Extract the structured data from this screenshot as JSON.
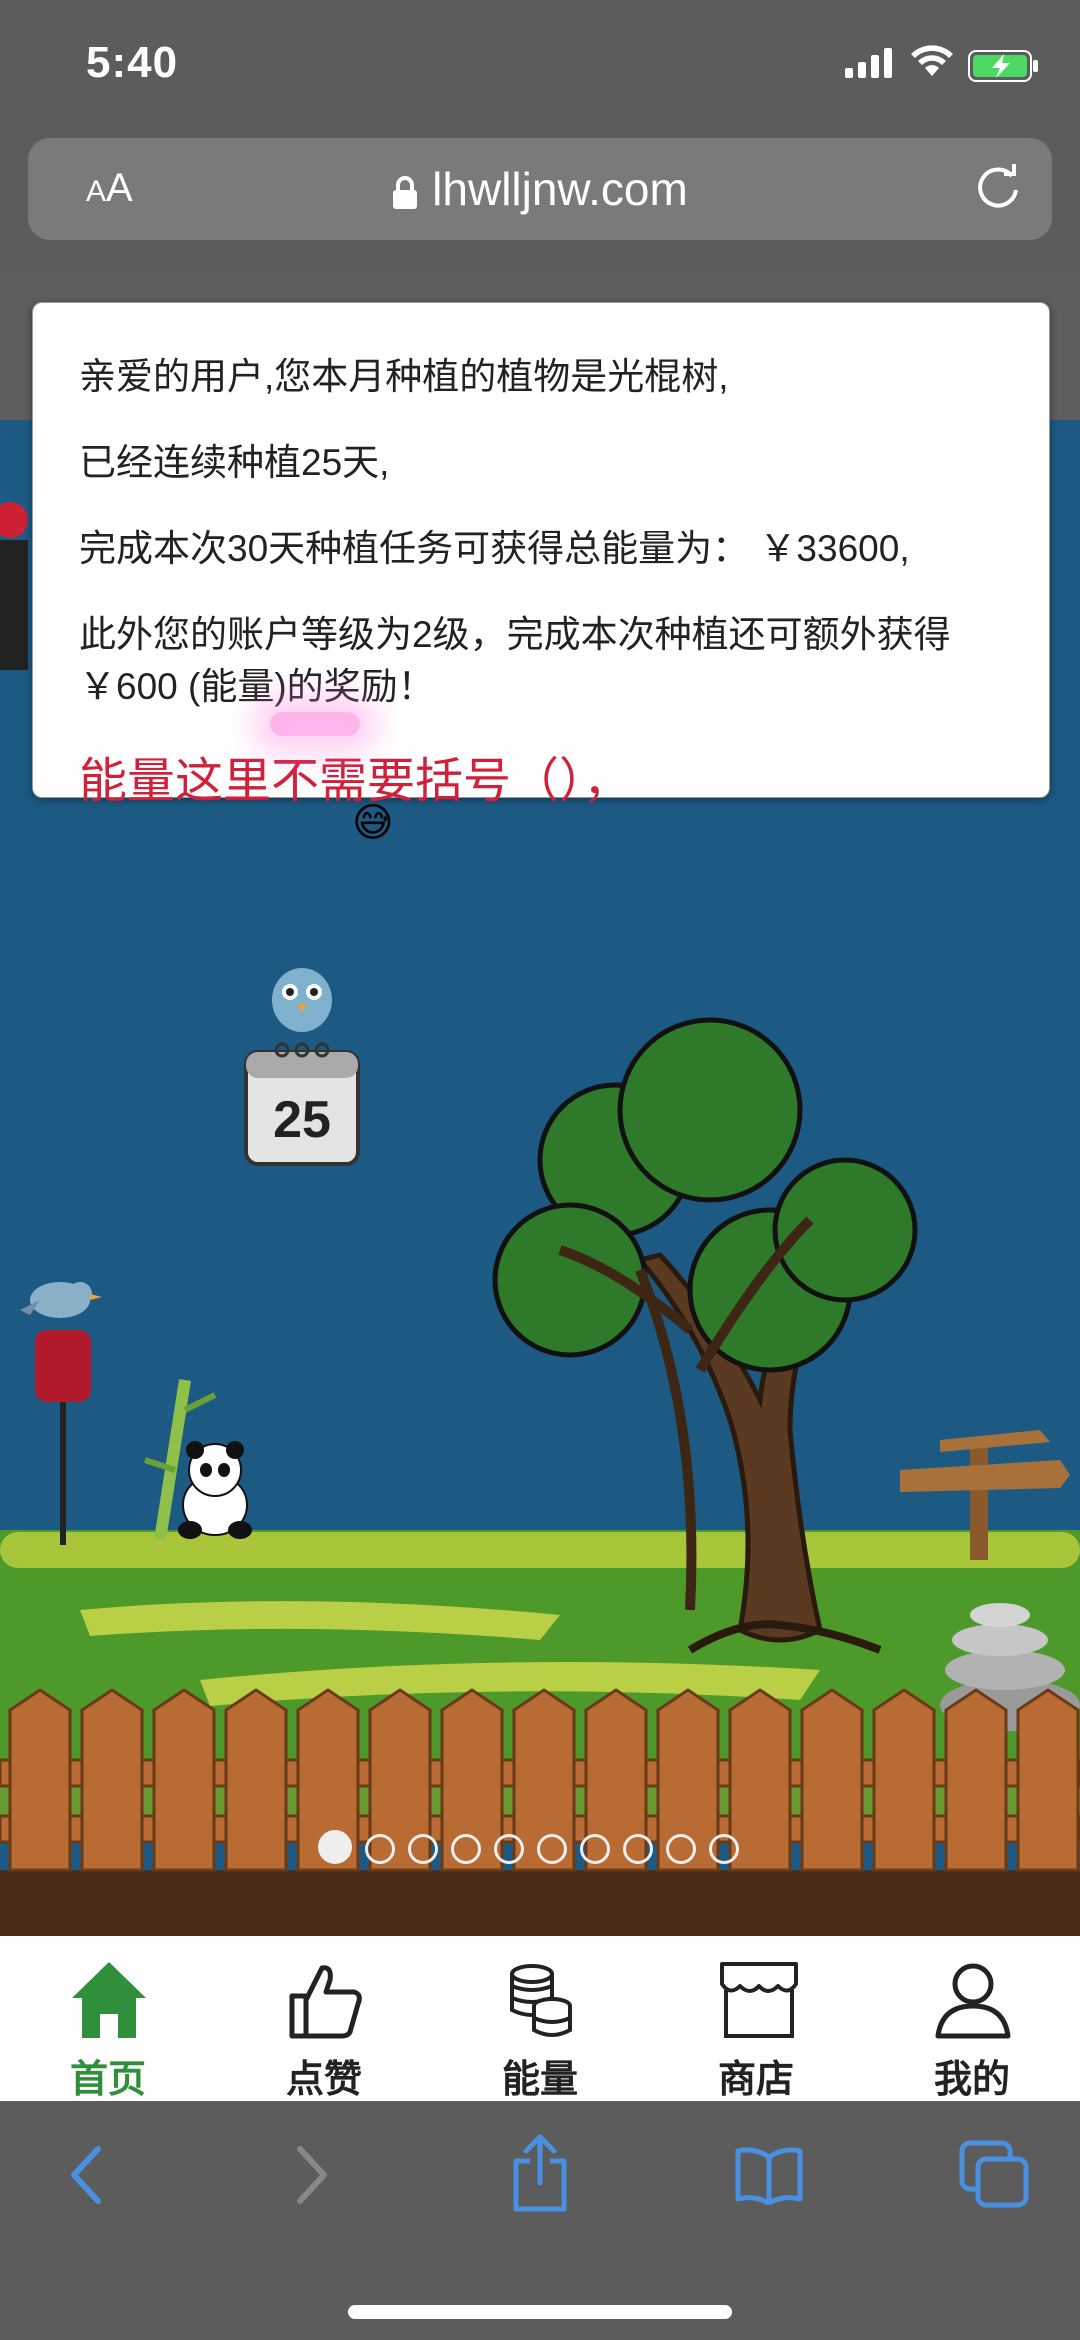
{
  "status": {
    "time": "5:40"
  },
  "browser": {
    "text_size_small": "A",
    "text_size_large": "A",
    "url": "lhwlljnw.com"
  },
  "dialog": {
    "line1": "亲爱的用户,您本月种植的植物是光棍树,",
    "line2": "已经连续种植25天,",
    "line3": "完成本次30天种植任务可获得总能量为： ￥33600,",
    "line4": "此外您的账户等级为2级，完成本次种植还可额外获得 ￥600 (能量)的奖励！",
    "annotation": "能量这里不需要括号（），",
    "emoji": "😅"
  },
  "calendar": {
    "day": "25"
  },
  "carousel": {
    "count": 10,
    "active": 0
  },
  "tabs": [
    {
      "label": "首页",
      "icon": "home-icon",
      "active": true
    },
    {
      "label": "点赞",
      "icon": "thumbs-up-icon",
      "active": false
    },
    {
      "label": "能量",
      "icon": "energy-coins-icon",
      "active": false
    },
    {
      "label": "商店",
      "icon": "store-icon",
      "active": false
    },
    {
      "label": "我的",
      "icon": "user-icon",
      "active": false
    }
  ],
  "colors": {
    "accent_green": "#2f8f3a",
    "annotation_red": "#d0203a",
    "browser_blue": "#4a90e2",
    "sky": "#1c5a84"
  }
}
